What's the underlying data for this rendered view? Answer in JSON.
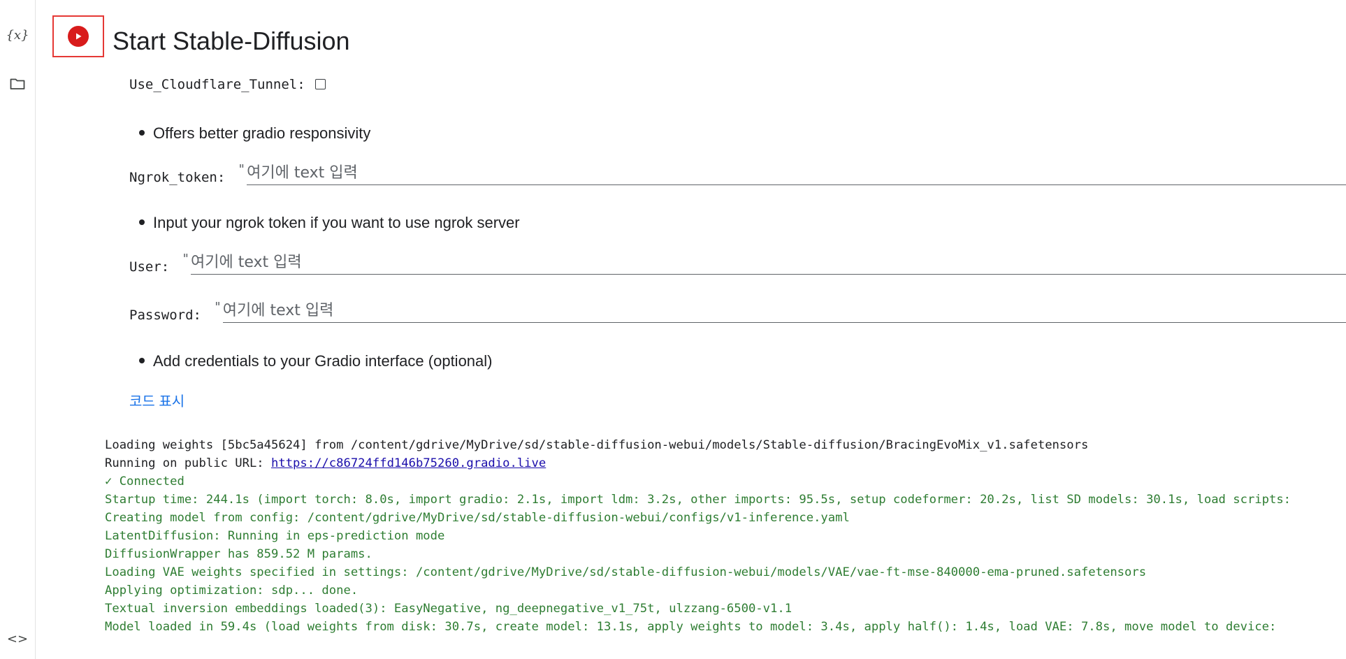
{
  "sidebar": {
    "variables_icon": "{x}",
    "files_icon": "folder-icon",
    "code_icon": "<>"
  },
  "cell": {
    "title": "Start Stable-Diffusion",
    "run_icon": "play-icon"
  },
  "form": {
    "cloudflare": {
      "label": "Use_Cloudflare_Tunnel:",
      "checked": false,
      "bullet": "Offers better gradio responsivity"
    },
    "ngrok": {
      "label": "Ngrok_token:",
      "quote": "\"",
      "placeholder": "여기에 text 입력",
      "value": "",
      "bullet": "Input your ngrok token if you want to use ngrok server"
    },
    "user": {
      "label": "User:",
      "quote": "\"",
      "placeholder": "여기에 text 입력",
      "value": ""
    },
    "password": {
      "label": "Password:",
      "quote": "\"",
      "placeholder": "여기에 text 입력",
      "value": "",
      "bullet": "Add credentials to your Gradio interface (optional)"
    },
    "show_code": "코드 표시"
  },
  "output": {
    "line1": "Loading weights [5bc5a45624] from /content/gdrive/MyDrive/sd/stable-diffusion-webui/models/Stable-diffusion/BracingEvoMix_v1.safetensors",
    "line2_prefix": "Running on public URL: ",
    "line2_link": "https://c86724ffd146b75260.gradio.live",
    "line3": "✓ Connected",
    "line4": "Startup time: 244.1s (import torch: 8.0s, import gradio: 2.1s, import ldm: 3.2s, other imports: 95.5s, setup codeformer: 20.2s, list SD models: 30.1s, load scripts: ",
    "line5": "Creating model from config: /content/gdrive/MyDrive/sd/stable-diffusion-webui/configs/v1-inference.yaml",
    "line6": "LatentDiffusion: Running in eps-prediction mode",
    "line7": "DiffusionWrapper has 859.52 M params.",
    "line8": "Loading VAE weights specified in settings: /content/gdrive/MyDrive/sd/stable-diffusion-webui/models/VAE/vae-ft-mse-840000-ema-pruned.safetensors",
    "line9": "Applying optimization: sdp... done.",
    "line10": "Textual inversion embeddings loaded(3): EasyNegative, ng_deepnegative_v1_75t, ulzzang-6500-v1.1",
    "line11": "Model loaded in 59.4s (load weights from disk: 30.7s, create model: 13.1s, apply weights to model: 3.4s, apply half(): 1.4s, load VAE: 7.8s, move model to device: "
  },
  "colors": {
    "run_button": "#d81b1b",
    "highlight_box": "#e53935",
    "link": "#1a73e8",
    "output_green": "#2e7d32"
  }
}
